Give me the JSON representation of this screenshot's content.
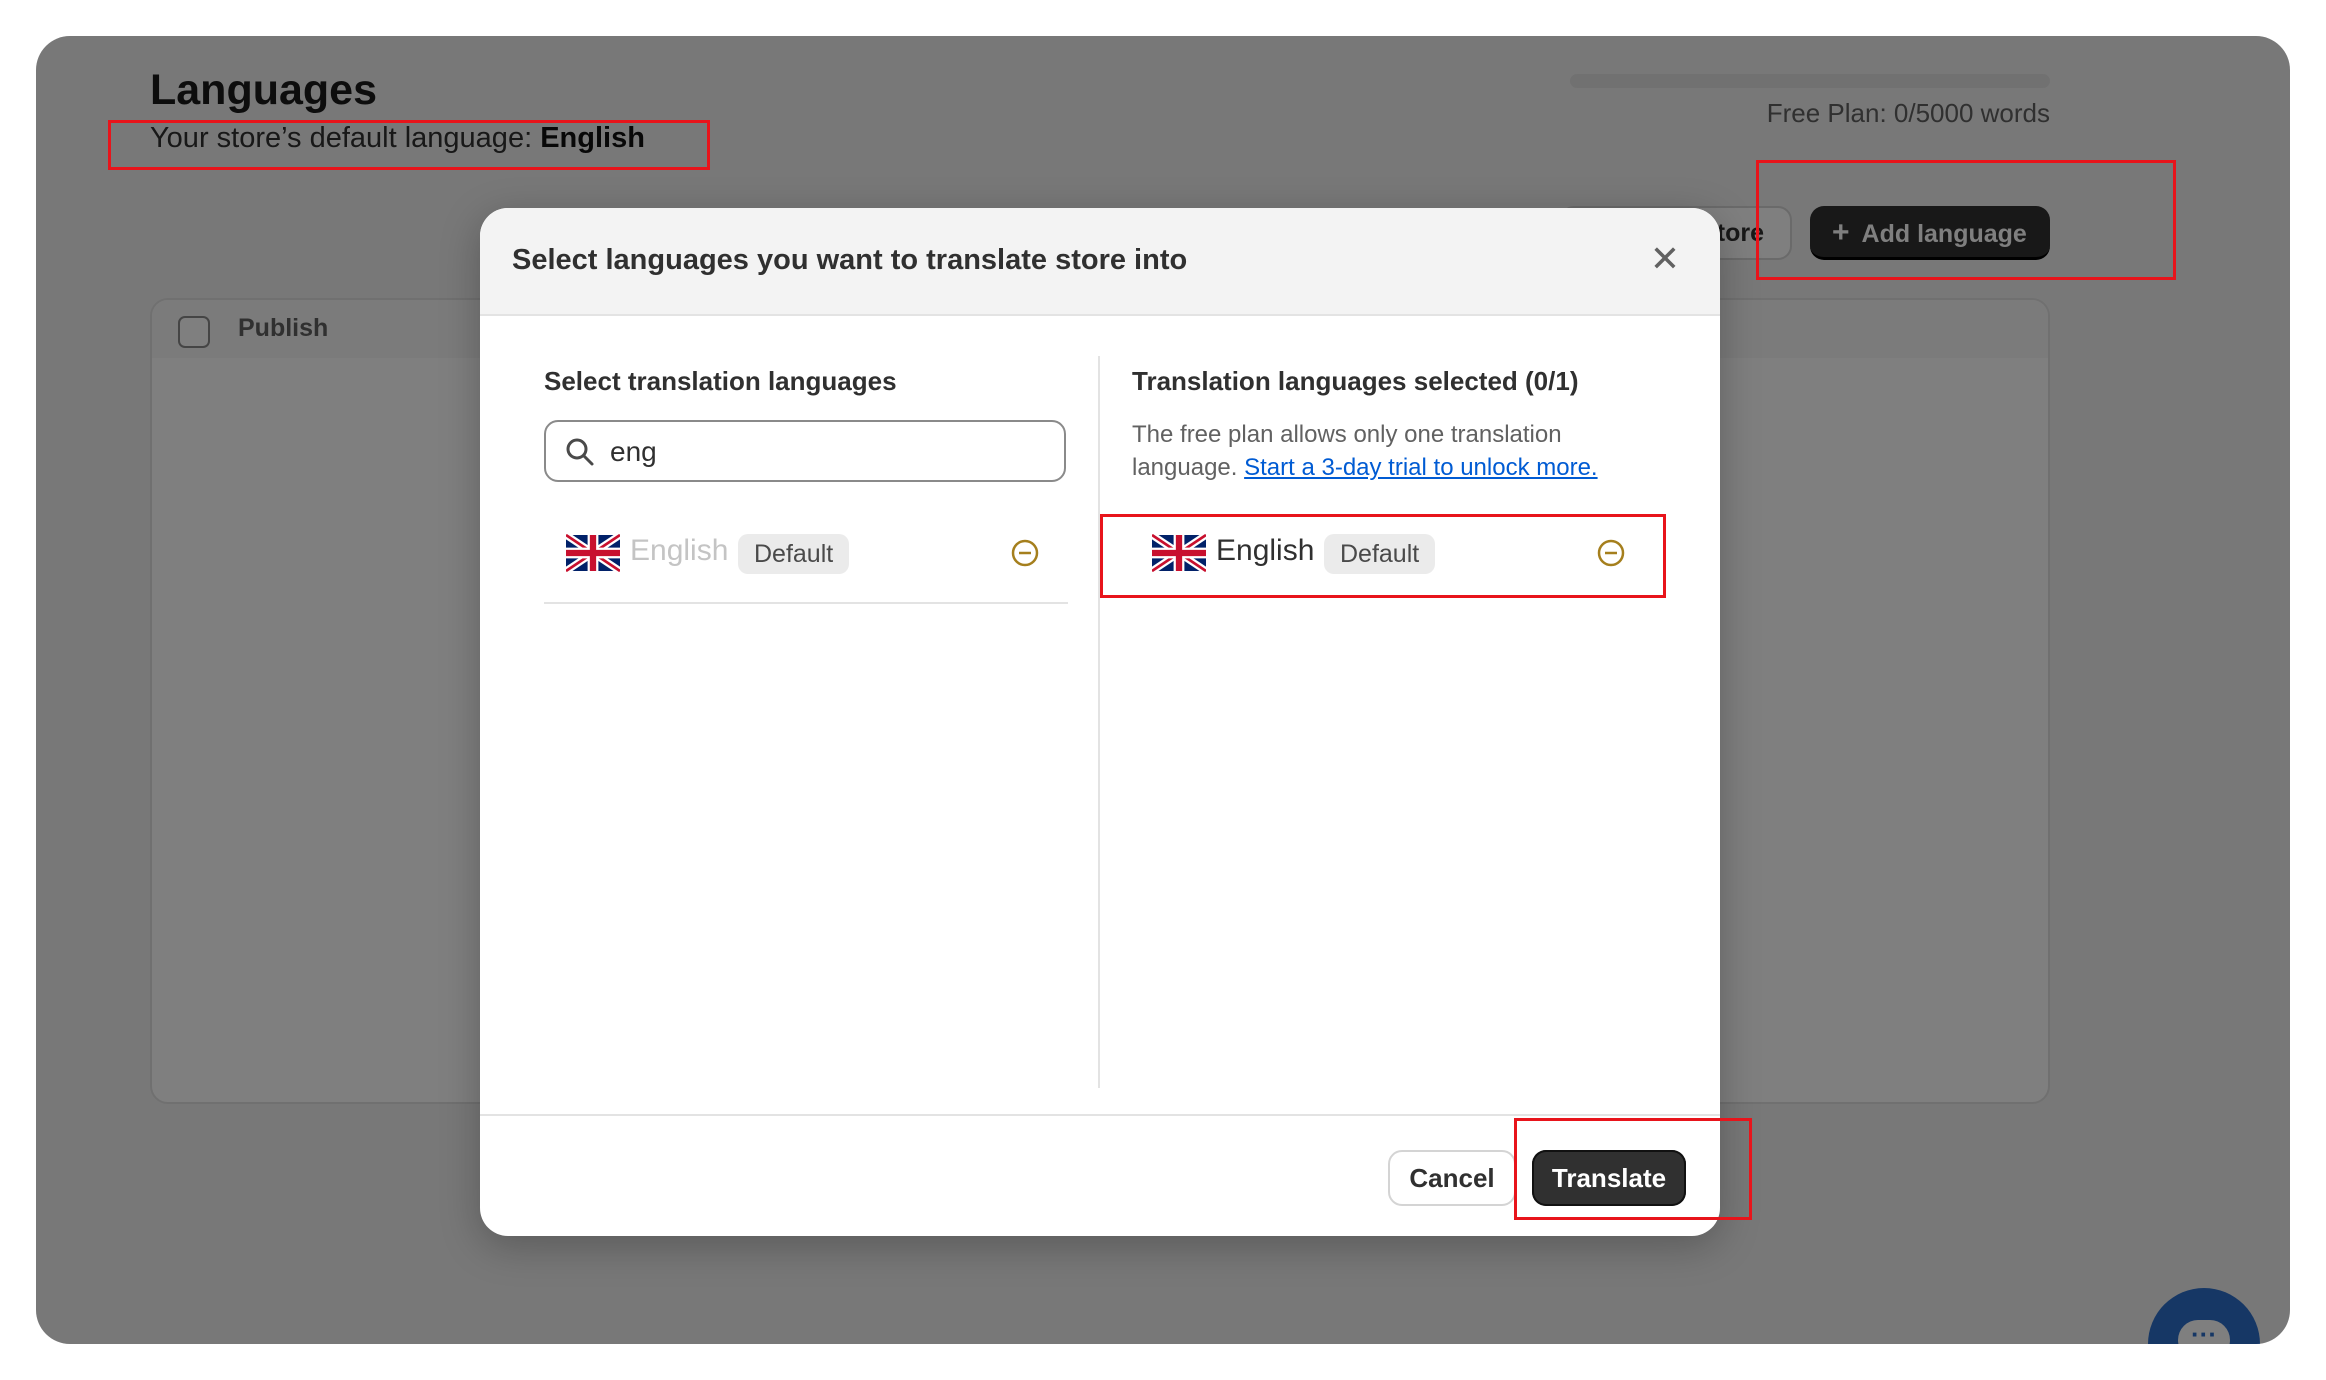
{
  "page": {
    "title": "Languages",
    "default_language_prefix": "Your store’s default language:",
    "default_language_value": "English",
    "plan_text": "Free Plan: 0/5000 words",
    "plan_progress": 0,
    "secondary_button_label": "tore",
    "add_language_label": "Add language",
    "table_header_label": "Publish"
  },
  "modal": {
    "title": "Select languages you want to translate store into",
    "left": {
      "title": "Select translation languages",
      "search_value": "eng",
      "results": [
        {
          "name": "English",
          "badge": "Default",
          "flag": "uk-flag",
          "disabled": true
        }
      ]
    },
    "right": {
      "title": "Translation languages selected (0/1)",
      "info_text": "The free plan allows only one translation language.",
      "info_link": "Start a 3-day trial to unlock more.",
      "selected": [
        {
          "name": "English",
          "badge": "Default",
          "flag": "uk-flag"
        }
      ]
    },
    "footer": {
      "cancel_label": "Cancel",
      "translate_label": "Translate"
    }
  },
  "colors": {
    "primary_button": "#303030",
    "link": "#005bd3",
    "annotation": "#e8141b",
    "chat_button": "#2c6ecb",
    "remove_icon": "#a57f1d"
  }
}
